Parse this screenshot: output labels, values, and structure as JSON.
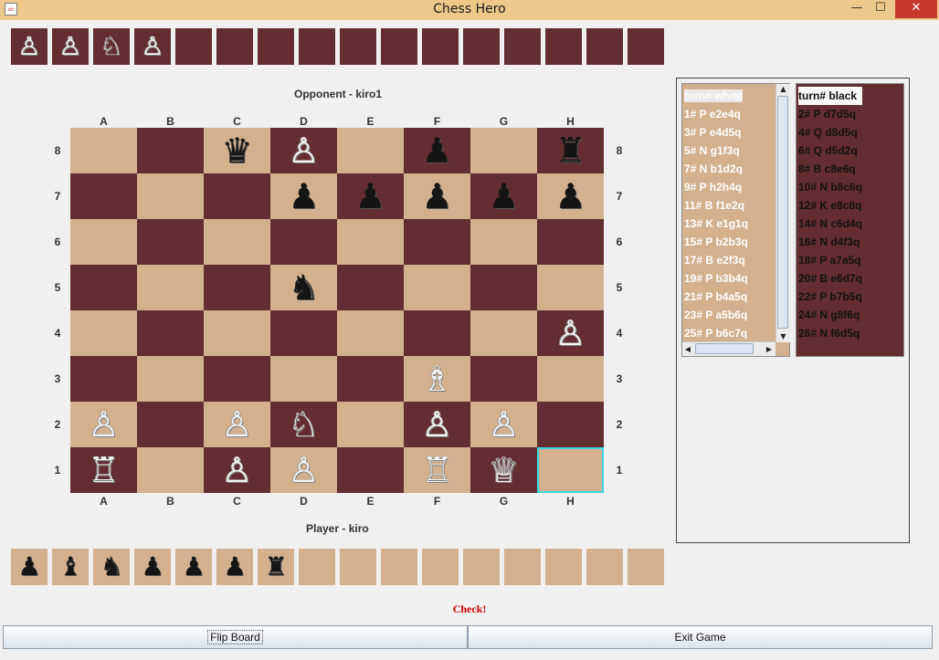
{
  "window": {
    "title": "Chess Hero",
    "minimize_glyph": "—",
    "maximize_glyph": "☐",
    "close_glyph": "✕",
    "app_icon": "java-cup-icon"
  },
  "opponent_label": "Opponent - kiro1",
  "player_label": "Player - kiro",
  "files": [
    "A",
    "B",
    "C",
    "D",
    "E",
    "F",
    "G",
    "H"
  ],
  "ranks": [
    "8",
    "7",
    "6",
    "5",
    "4",
    "3",
    "2",
    "1"
  ],
  "board": {
    "rows": [
      [
        "",
        "",
        "bQ",
        "wP",
        "",
        "bP",
        "",
        "bR"
      ],
      [
        "",
        "",
        "",
        "bP",
        "bP",
        "bP",
        "bP",
        "bP"
      ],
      [
        "",
        "",
        "",
        "",
        "",
        "",
        "",
        ""
      ],
      [
        "",
        "",
        "",
        "bN",
        "",
        "",
        "",
        ""
      ],
      [
        "",
        "",
        "",
        "",
        "",
        "",
        "",
        "wP"
      ],
      [
        "",
        "",
        "",
        "",
        "",
        "wB",
        "",
        ""
      ],
      [
        "wP",
        "",
        "wP",
        "wN",
        "",
        "wP",
        "wP",
        ""
      ],
      [
        "wR",
        "",
        "wP",
        "wP",
        "",
        "wR",
        "wQ",
        ""
      ]
    ],
    "selected": "H1",
    "light_color": "#d3b08e",
    "dark_color": "#632d31",
    "highlight_color": "#39d7e0"
  },
  "captured_by_player": [
    "wP",
    "wP",
    "wN",
    "wP",
    "",
    "",
    "",
    "",
    "",
    "",
    "",
    "",
    "",
    "",
    "",
    ""
  ],
  "captured_by_opponent": [
    "bP",
    "bB",
    "bN",
    "bP",
    "bP",
    "bP",
    "bR",
    "",
    "",
    "",
    "",
    "",
    "",
    "",
    "",
    ""
  ],
  "move_lists": {
    "white": [
      "turn# white",
      "1# P e2e4q",
      "3# P e4d5q",
      "5# N g1f3q",
      "7# N b1d2q",
      "9# P h2h4q",
      "11# B f1e2q",
      "13# K e1g1q",
      "15# P b2b3q",
      "17# B e2f3q",
      "19# P b3b4q",
      "21# P b4a5q",
      "23# P a5b6q",
      "25# P b6c7q"
    ],
    "black": [
      "turn# black",
      "2# P d7d5q",
      "4# Q d8d5q",
      "6# Q d5d2q",
      "8# B c8e6q",
      "10# N b8c6q",
      "12# K e8c8q",
      "14# N c6d4q",
      "16# N d4f3q",
      "18# P a7a5q",
      "20# B e6d7q",
      "22# P b7b5q",
      "24# N g8f6q",
      "26# N f6d5q"
    ]
  },
  "status_text": "Check!",
  "buttons": {
    "flip": "Flip Board",
    "exit": "Exit Game"
  },
  "piece_glyphs": {
    "wP": "♙",
    "wN": "♘",
    "wB": "♗",
    "wR": "♖",
    "wQ": "♕",
    "wK": "♔",
    "bP": "♟",
    "bN": "♞",
    "bB": "♝",
    "bR": "♜",
    "bQ": "♛",
    "bK": "♚"
  },
  "piece_names": {
    "P": "pawn",
    "N": "knight",
    "B": "bishop",
    "R": "rook",
    "Q": "queen",
    "K": "king"
  }
}
